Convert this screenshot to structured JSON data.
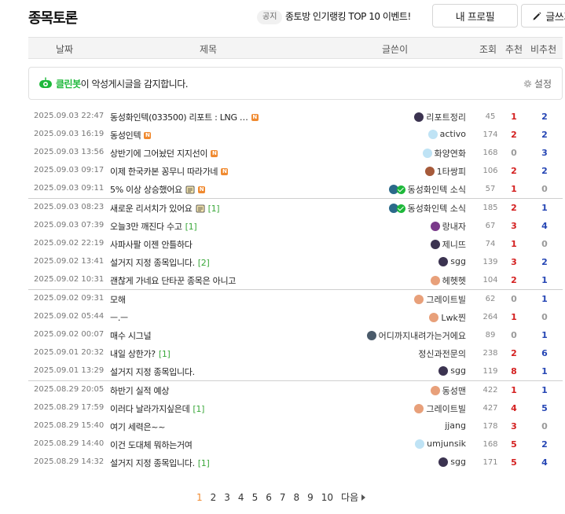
{
  "header": {
    "title": "종목토론",
    "notice_badge": "공지",
    "notice_text": "종토방 인기랭킹 TOP 10 이벤트!",
    "profile_button": "내 프로필",
    "write_button": "글쓰기"
  },
  "columns": {
    "date": "날짜",
    "title": "제목",
    "author": "글쓴이",
    "views": "조회",
    "up": "추천",
    "down": "비추천"
  },
  "cleanbot": {
    "name": "클린봇",
    "message": "이 악성게시글을 감지합니다.",
    "settings": "설정"
  },
  "posts": [
    {
      "date": "2025.09.03 22:47",
      "title": "동성화인텍(033500) 리포트 : LNG …",
      "comments": "",
      "new": true,
      "author": "리포트정리",
      "views": "45",
      "up": "1",
      "down": "2",
      "avatar": "#3b3350"
    },
    {
      "date": "2025.09.03 16:19",
      "title": "동성인텍",
      "comments": "",
      "new": true,
      "author": "activo",
      "views": "174",
      "up": "2",
      "down": "2",
      "avatar": "#bfe3f5"
    },
    {
      "date": "2025.09.03 13:56",
      "title": "상반기에 그어놨던 지지선이",
      "comments": "",
      "new": true,
      "author": "화양연화",
      "views": "168",
      "up": "0",
      "down": "3",
      "avatar": "#bfe3f5"
    },
    {
      "date": "2025.09.03 09:17",
      "title": "이제 한국카본 꽁무니 따라가네",
      "comments": "",
      "new": true,
      "author": "1타쌍피",
      "views": "106",
      "up": "2",
      "down": "2",
      "avatar": "#a65a3a"
    },
    {
      "date": "2025.09.03 09:11",
      "title": "5% 이상 상승했어요",
      "comments": "",
      "new": true,
      "deco": true,
      "author": "동성화인텍 소식",
      "views": "57",
      "up": "1",
      "down": "0",
      "avatar": "#2b6a8a",
      "verified": true
    },
    {
      "date": "2025.09.03 08:23",
      "title": "새로운 리서치가 있어요",
      "comments": "[1]",
      "new": false,
      "deco": true,
      "author": "동성화인텍 소식",
      "views": "185",
      "up": "2",
      "down": "1",
      "avatar": "#2b6a8a",
      "verified": true
    },
    {
      "date": "2025.09.03 07:39",
      "title": "오늘3만 깨진다 수고",
      "comments": "[1]",
      "new": false,
      "author": "랑내자",
      "views": "67",
      "up": "3",
      "down": "4",
      "avatar": "#7a3a8a"
    },
    {
      "date": "2025.09.02 22:19",
      "title": "사파사팔 이젠 안틀하다",
      "comments": "",
      "new": false,
      "author": "제니뜨",
      "views": "74",
      "up": "1",
      "down": "0",
      "avatar": "#3b3350"
    },
    {
      "date": "2025.09.02 13:41",
      "title": "설거지 지정 종목입니다.",
      "comments": "[2]",
      "new": false,
      "author": "sgg",
      "views": "139",
      "up": "3",
      "down": "2",
      "avatar": "#3b3350"
    },
    {
      "date": "2025.09.02 10:31",
      "title": "괜찮게 가네요 단타꾼 종목은 아니고",
      "comments": "",
      "new": false,
      "author": "헤헷헷",
      "views": "104",
      "up": "2",
      "down": "1",
      "avatar": "#e8a07a"
    },
    {
      "date": "2025.09.02 09:31",
      "title": "모해",
      "comments": "",
      "new": false,
      "author": "그레이트빌",
      "views": "62",
      "up": "0",
      "down": "1",
      "avatar": "#e8a07a"
    },
    {
      "date": "2025.09.02 05:44",
      "title": "ㅡ.ㅡ",
      "comments": "",
      "new": false,
      "author": "Lwk찐",
      "views": "264",
      "up": "1",
      "down": "0",
      "avatar": "#e8a07a"
    },
    {
      "date": "2025.09.02 00:07",
      "title": "매수 시그널",
      "comments": "",
      "new": false,
      "author": "어디까지내려가는거에요",
      "views": "89",
      "up": "0",
      "down": "1",
      "avatar": "#4a5a6a"
    },
    {
      "date": "2025.09.01 20:32",
      "title": "내일 상한가?",
      "comments": "[1]",
      "new": false,
      "author": "정신과전문의",
      "views": "238",
      "up": "2",
      "down": "6",
      "avatar": ""
    },
    {
      "date": "2025.09.01 13:29",
      "title": "설거지 지정 종목입니다.",
      "comments": "",
      "new": false,
      "author": "sgg",
      "views": "119",
      "up": "8",
      "down": "1",
      "avatar": "#3b3350"
    },
    {
      "date": "2025.08.29 20:05",
      "title": "하반기 실적 예상",
      "comments": "",
      "new": false,
      "author": "동성맨",
      "views": "422",
      "up": "1",
      "down": "1",
      "avatar": "#e8a07a"
    },
    {
      "date": "2025.08.29 17:59",
      "title": "이러다 날라가지싶은데",
      "comments": "[1]",
      "new": false,
      "author": "그레이트빌",
      "views": "427",
      "up": "4",
      "down": "5",
      "avatar": "#e8a07a"
    },
    {
      "date": "2025.08.29 15:40",
      "title": "여기 세력은~~",
      "comments": "",
      "new": false,
      "author": "jjang",
      "views": "178",
      "up": "3",
      "down": "0",
      "avatar": ""
    },
    {
      "date": "2025.08.29 14:40",
      "title": "이건 도대체 뭐하는거여",
      "comments": "",
      "new": false,
      "author": "umjunsik",
      "views": "168",
      "up": "5",
      "down": "2",
      "avatar": "#bfe3f5"
    },
    {
      "date": "2025.08.29 14:32",
      "title": "설거지 지정 종목입니다.",
      "comments": "[1]",
      "new": false,
      "author": "sgg",
      "views": "171",
      "up": "5",
      "down": "4",
      "avatar": "#3b3350"
    }
  ],
  "pagination": {
    "pages": [
      "1",
      "2",
      "3",
      "4",
      "5",
      "6",
      "7",
      "8",
      "9",
      "10"
    ],
    "current": "1",
    "next": "다음"
  },
  "colors": {
    "up": "#d42020",
    "down": "#2646b4",
    "zero": "#9a9a9a",
    "cleanbot": "#1db83a",
    "new_badge": "#f08a30"
  }
}
